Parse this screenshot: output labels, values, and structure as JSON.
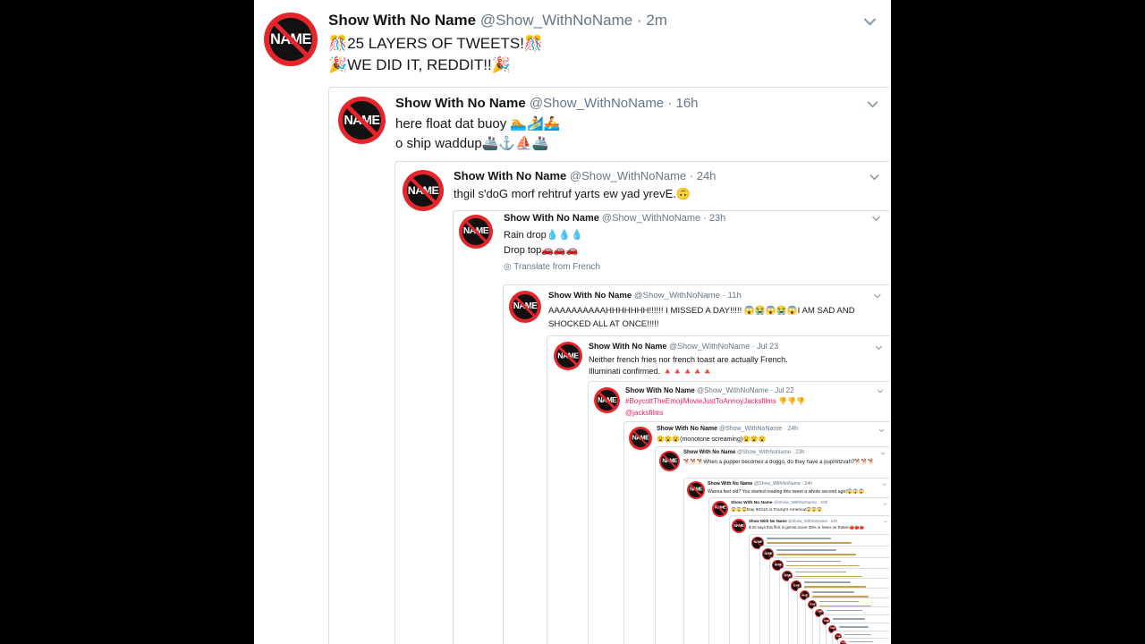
{
  "tweets": [
    {
      "name": "Show With No Name",
      "handle": "@Show_WithNoName",
      "time": "2m",
      "lines": [
        "🎊25 LAYERS OF TWEETS!🎊",
        "🎉WE DID IT, REDDIT!!🎉"
      ]
    },
    {
      "name": "Show With No Name",
      "handle": "@Show_WithNoName",
      "time": "16h",
      "lines": [
        "here float dat buoy 🏊🏄🚣",
        "o ship waddup🚢⚓⛵🚢"
      ]
    },
    {
      "name": "Show With No Name",
      "handle": "@Show_WithNoName",
      "time": "24h",
      "lines": [
        "thgil s'doG morf rehtruf yarts ew yad yrevE.🙃"
      ]
    },
    {
      "name": "Show With No Name",
      "handle": "@Show_WithNoName",
      "time": "23h",
      "lines": [
        "Rain drop💧💧💧",
        "Drop top🚗🚗🚗"
      ],
      "translate": "Translate from French"
    },
    {
      "name": "Show With No Name",
      "handle": "@Show_WithNoName",
      "time": "11h",
      "lines": [
        "AAAAAAAAAAHHHHHHH!!!!!! I MISSED A DAY!!!!! 😱😭😱😭😱I AM SAD AND SHOCKED ALL AT ONCE!!!!!"
      ]
    },
    {
      "name": "Show With No Name",
      "handle": "@Show_WithNoName",
      "time": "Jul 23",
      "lines": [
        "Neither french fries nor french toast are actually French.",
        "Illuminati confirmed. 🔺🔺🔺🔺🔺"
      ]
    },
    {
      "name": "Show With No Name",
      "handle": "@Show_WithNoName",
      "time": "Jul 22",
      "lines": [
        "#BoycottTheEmojiMovieJustToAnnoyJacksfilms 👎👎👎",
        "@jacksfilms"
      ]
    },
    {
      "name": "Show With No Name",
      "handle": "@Show_WithNoName",
      "time": "24h",
      "lines": [
        "😮😮😮(monotone screaming)😮😮😮"
      ]
    },
    {
      "name": "Show With No Name",
      "handle": "@Show_WithNoName",
      "time": "23h",
      "lines": [
        "🐕🐕🐕When a pupper becomes a doggo, do they have a pupmitzvah?🐕🐕🐕"
      ]
    },
    {
      "name": "Show With No Name",
      "handle": "@Show_WithNoName",
      "time": "24h",
      "lines": [
        "Wanna feel old? You started reading this tweet a whole second ago!😱😱😱"
      ]
    },
    {
      "name": "Show With No Name",
      "handle": "@Show_WithNoName",
      "time": "23h",
      "lines": [
        "😱😱😱Day 90210 in Trump's America!😱😱😱"
      ]
    },
    {
      "name": "Show With No Name",
      "handle": "@Show_WithNoName",
      "time": "24h",
      "lines": [
        "$ 20 says this flick is gonna score 30% or lower on Rotten🍅🍅🍅"
      ]
    }
  ],
  "avatar_text": "NAME",
  "colors": {
    "avatar_red": "#e5252a",
    "link_blue": "#1da1f2",
    "meta_gray": "#657786",
    "border": "#d8dee3"
  },
  "icons": {
    "chevron": "chevron-down-icon",
    "globe": "globe-icon"
  }
}
